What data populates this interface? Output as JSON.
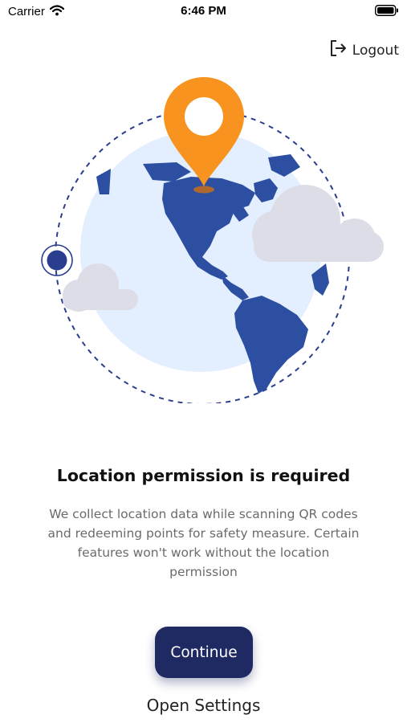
{
  "status_bar": {
    "carrier": "Carrier",
    "time": "6:46 PM",
    "wifi_icon": "wifi-icon",
    "battery_icon": "battery-icon"
  },
  "header": {
    "logout_label": "Logout",
    "logout_icon": "logout-icon"
  },
  "illustration": {
    "globe_icon": "globe-illustration",
    "pin_icon": "location-pin-icon",
    "colors": {
      "ocean": "#e3efff",
      "land": "#2d4fa2",
      "pin": "#f7931e",
      "orbit": "#2b3d8f",
      "cloud": "#dddde8"
    }
  },
  "main": {
    "title": "Location permission is required",
    "description": "We collect location data while scanning QR codes and redeeming points for safety measure. Certain features won't work without the location permission",
    "continue_label": "Continue",
    "open_settings_label": "Open Settings"
  },
  "colors": {
    "button_bg": "#1f2a63",
    "button_text": "#ffffff",
    "description_text": "#6b6b6b"
  }
}
